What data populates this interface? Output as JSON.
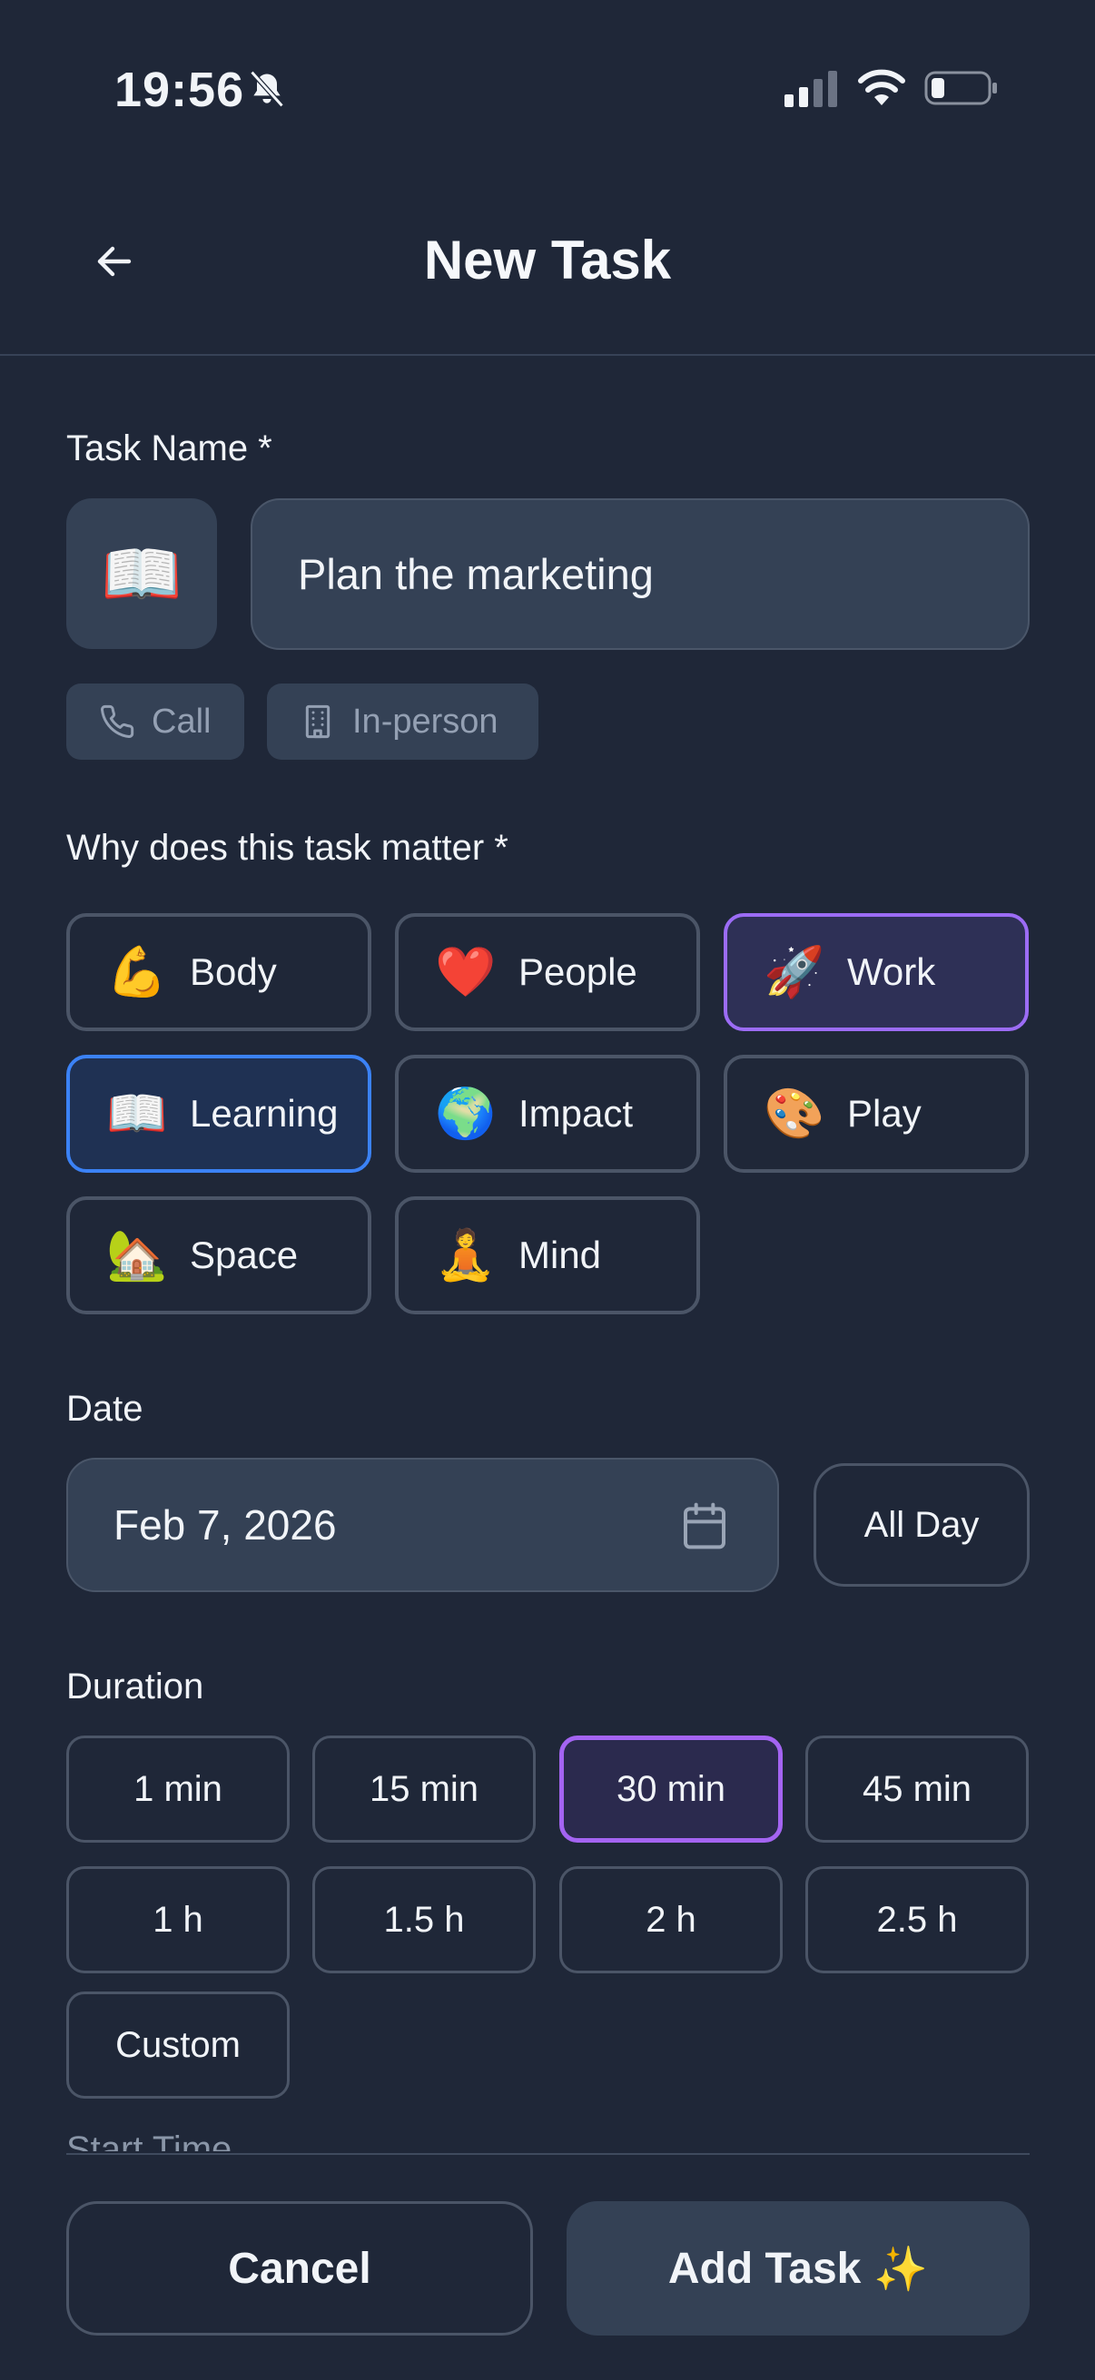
{
  "status_bar": {
    "time": "19:56"
  },
  "header": {
    "title": "New Task"
  },
  "task_name": {
    "label": "Task Name *",
    "emoji": "📖",
    "value": "Plan the marketing"
  },
  "location_chips": [
    {
      "label": "Call",
      "icon": "phone-icon"
    },
    {
      "label": "In-person",
      "icon": "building-icon"
    }
  ],
  "why": {
    "label": "Why does this task matter *",
    "options": [
      {
        "emoji": "💪",
        "label": "Body",
        "selected": "none"
      },
      {
        "emoji": "❤️",
        "label": "People",
        "selected": "none"
      },
      {
        "emoji": "🚀",
        "label": "Work",
        "selected": "purple"
      },
      {
        "emoji": "📖",
        "label": "Learning",
        "selected": "blue"
      },
      {
        "emoji": "🌍",
        "label": "Impact",
        "selected": "none"
      },
      {
        "emoji": "🎨",
        "label": "Play",
        "selected": "none"
      },
      {
        "emoji": "🏡",
        "label": "Space",
        "selected": "none"
      },
      {
        "emoji": "🧘",
        "label": "Mind",
        "selected": "none"
      }
    ]
  },
  "date": {
    "label": "Date",
    "value": "Feb 7, 2026",
    "all_day_label": "All Day"
  },
  "duration": {
    "label": "Duration",
    "options": [
      "1 min",
      "15 min",
      "30 min",
      "45 min",
      "1 h",
      "1.5 h",
      "2 h",
      "2.5 h",
      "Custom"
    ],
    "selected": "30 min"
  },
  "start_time": {
    "label": "Start Time"
  },
  "footer": {
    "cancel_label": "Cancel",
    "add_label": "Add Task",
    "add_emoji": "✨"
  },
  "colors": {
    "background": "#1f2738",
    "field": "#344155",
    "accent_purple": "#9c6cf5",
    "accent_blue": "#3b82f6"
  }
}
